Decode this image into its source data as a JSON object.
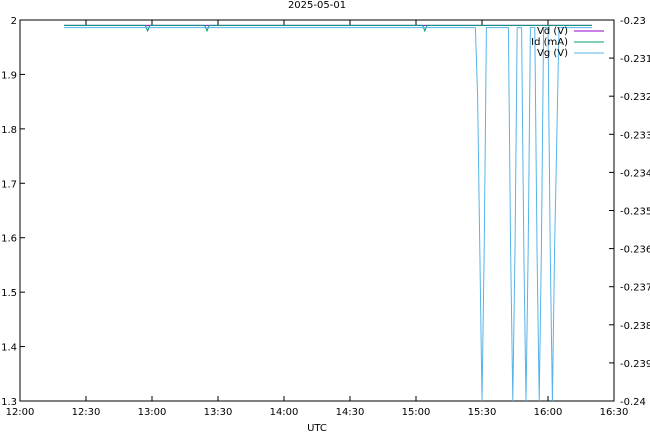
{
  "chart_data": {
    "type": "line",
    "title": "2025-05-01",
    "xlabel": "UTC",
    "ylabel": "",
    "y2label": "",
    "x_ticks": [
      "12:00",
      "12:30",
      "13:00",
      "13:30",
      "14:00",
      "14:30",
      "15:00",
      "15:30",
      "16:00",
      "16:30"
    ],
    "y_ticks": [
      "1.3",
      "1.4",
      "1.5",
      "1.6",
      "1.7",
      "1.8",
      "1.9",
      "2"
    ],
    "y2_ticks": [
      "-0.24",
      "-0.239",
      "-0.238",
      "-0.237",
      "-0.236",
      "-0.235",
      "-0.234",
      "-0.233",
      "-0.232",
      "-0.231",
      "-0.23"
    ],
    "xlim": [
      "12:00",
      "16:30"
    ],
    "ylim": [
      1.3,
      2.0
    ],
    "y2lim": [
      -0.24,
      -0.23
    ],
    "grid": false,
    "legend_position": "top-right",
    "series": [
      {
        "name": "Vd (V)",
        "axis": "y",
        "color": "#9400d3",
        "x": [
          "12:20",
          "16:20"
        ],
        "y": [
          1.99,
          1.99
        ]
      },
      {
        "name": "Id (mA)",
        "axis": "y",
        "color": "#009e73",
        "x": [
          "12:20",
          "12:57",
          "12:58",
          "12:59",
          "13:24",
          "13:25",
          "13:26",
          "15:03",
          "15:04",
          "15:05",
          "16:20"
        ],
        "y": [
          1.99,
          1.99,
          1.98,
          1.99,
          1.99,
          1.98,
          1.99,
          1.99,
          1.98,
          1.99,
          1.99
        ]
      },
      {
        "name": "Vg (V)",
        "axis": "y2",
        "color": "#56b4e9",
        "x": [
          "12:20",
          "15:25",
          "15:27",
          "15:28",
          "15:29",
          "15:30",
          "15:31",
          "15:32",
          "15:40",
          "15:42",
          "15:43",
          "15:44",
          "15:45",
          "15:46",
          "15:48",
          "15:49",
          "15:50",
          "15:51",
          "15:52",
          "15:54",
          "15:55",
          "15:56",
          "15:57",
          "15:58",
          "16:00",
          "16:01",
          "16:02",
          "16:03",
          "16:05",
          "16:06",
          "16:07",
          "16:20"
        ],
        "y": [
          -0.2302,
          -0.2302,
          -0.2302,
          -0.232,
          -0.236,
          -0.24,
          -0.236,
          -0.2302,
          -0.2302,
          -0.2302,
          -0.236,
          -0.24,
          -0.236,
          -0.2302,
          -0.2302,
          -0.236,
          -0.24,
          -0.236,
          -0.2302,
          -0.2302,
          -0.236,
          -0.24,
          -0.236,
          -0.2302,
          -0.2302,
          -0.236,
          -0.24,
          -0.236,
          -0.2302,
          -0.2302,
          -0.2302,
          -0.2302
        ]
      }
    ]
  }
}
